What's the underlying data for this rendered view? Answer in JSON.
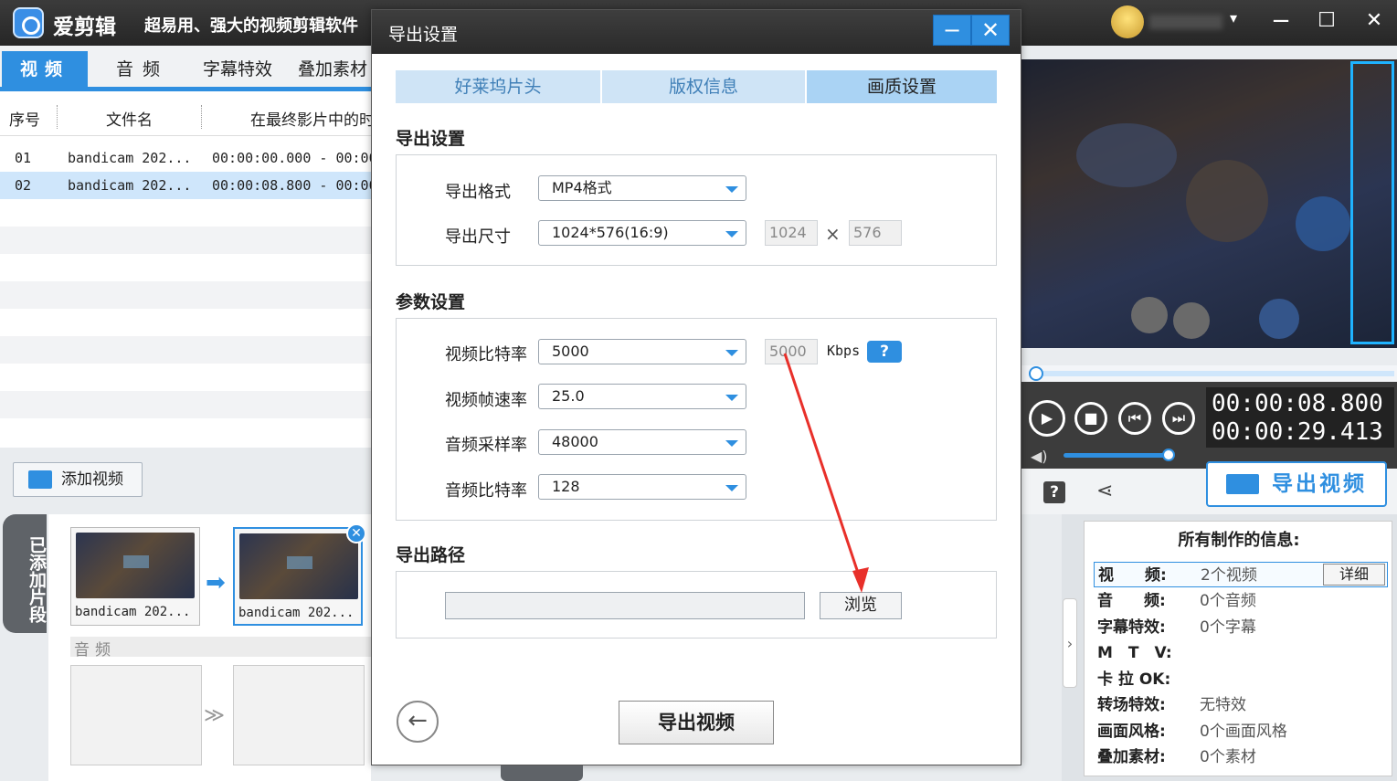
{
  "app": {
    "name": "爱剪辑",
    "slogan": "超易用、强大的视频剪辑软件",
    "user_dropdown": "▾",
    "window_min": "−",
    "window_max": "☐",
    "window_close": "✕"
  },
  "left": {
    "tabs": [
      "视频",
      "音频",
      "字幕特效",
      "叠加素材"
    ],
    "columns": [
      "序号",
      "文件名",
      "在最终影片中的时间"
    ],
    "rows": [
      {
        "index": "01",
        "file": "bandicam 202...",
        "time": "00:00:00.000 - 00:00"
      },
      {
        "index": "02",
        "file": "bandicam 202...",
        "time": "00:00:08.800 - 00:00"
      }
    ],
    "add_video": "添加视频",
    "added_clips": "已添加片段",
    "clips": [
      "bandicam 202...",
      "bandicam 202..."
    ],
    "audio_label": "音频"
  },
  "dialog": {
    "title": "导出设置",
    "min": "−",
    "close": "✕",
    "steps": [
      "好莱坞片头",
      "版权信息",
      "画质设置"
    ],
    "export_settings": {
      "title": "导出设置",
      "format_label": "导出格式",
      "format_value": "MP4格式",
      "size_label": "导出尺寸",
      "size_value": "1024*576(16:9)",
      "width": "1024",
      "times": "×",
      "height": "576"
    },
    "params": {
      "title": "参数设置",
      "video_bitrate_label": "视频比特率",
      "video_bitrate_value": "5000",
      "video_bitrate_custom": "5000",
      "kbps": "Kbps",
      "help": "?",
      "fps_label": "视频帧速率",
      "fps_value": "25.0",
      "audio_sample_label": "音频采样率",
      "audio_sample_value": "48000",
      "audio_bitrate_label": "音频比特率",
      "audio_bitrate_value": "128"
    },
    "path": {
      "title": "导出路径",
      "value": "",
      "browse": "浏览"
    },
    "back": "←",
    "export": "导出视频"
  },
  "player": {
    "time_current": "00:00:08.800",
    "time_total": "00:00:29.413",
    "export_video": "导出视频"
  },
  "info": {
    "title": "所有制作的信息:",
    "rows": [
      {
        "key": "视　　频:",
        "value": "2个视频"
      },
      {
        "key": "音　　频:",
        "value": "0个音频"
      },
      {
        "key": "字幕特效:",
        "value": "0个字幕"
      },
      {
        "key": "M　T　V:",
        "value": ""
      },
      {
        "key": "卡 拉 OK:",
        "value": ""
      },
      {
        "key": "转场特效:",
        "value": "无特效"
      },
      {
        "key": "画面风格:",
        "value": "0个画面风格"
      },
      {
        "key": "叠加素材:",
        "value": "0个素材"
      }
    ],
    "detail": "详细"
  }
}
